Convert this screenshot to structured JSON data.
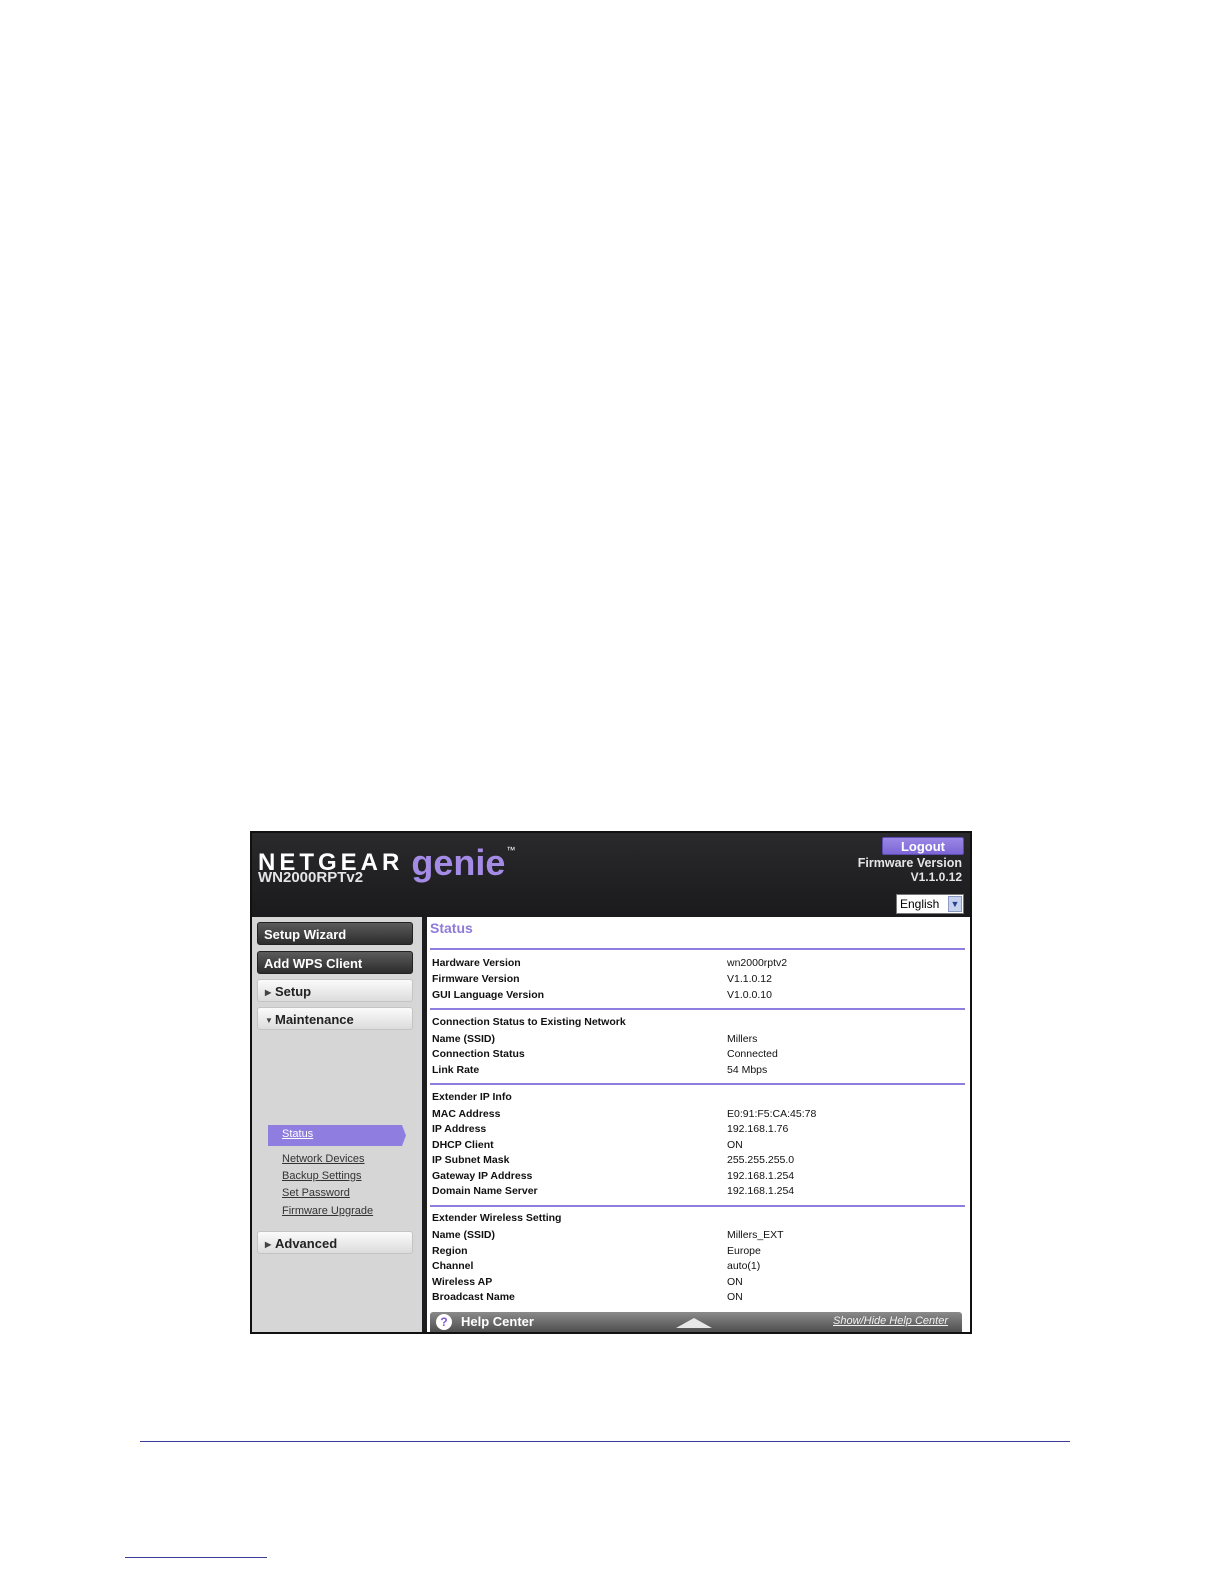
{
  "header": {
    "brand_netgear": "NETGEAR",
    "brand_genie": "genie",
    "brand_tm": "™",
    "model": "WN2000RPTv2",
    "logout_label": "Logout",
    "firmware_label": "Firmware Version",
    "firmware_value": "V1.1.0.12",
    "language_selected": "English"
  },
  "sidebar": {
    "setup_wizard": "Setup Wizard",
    "add_wps_client": "Add WPS Client",
    "setup": "Setup",
    "maintenance": "Maintenance",
    "maintenance_items": [
      "Status",
      "Network Devices",
      "Backup Settings",
      "Set Password",
      "Firmware Upgrade"
    ],
    "advanced": "Advanced"
  },
  "status": {
    "title": "Status",
    "hardware_version_label": "Hardware Version",
    "hardware_version_value": "wn2000rptv2",
    "firmware_version_label": "Firmware Version",
    "firmware_version_value": "V1.1.0.12",
    "gui_language_label": "GUI Language Version",
    "gui_language_value": "V1.0.0.10",
    "connection_section": "Connection Status to Existing Network",
    "conn_name_label": "Name (SSID)",
    "conn_name_value": "Millers",
    "conn_status_label": "Connection Status",
    "conn_status_value": "Connected",
    "link_rate_label": "Link Rate",
    "link_rate_value": "54 Mbps",
    "ip_section": "Extender IP Info",
    "mac_label": "MAC Address",
    "mac_value": "E0:91:F5:CA:45:78",
    "ip_label": "IP Address",
    "ip_value": "192.168.1.76",
    "dhcp_label": "DHCP Client",
    "dhcp_value": "ON",
    "subnet_label": "IP Subnet Mask",
    "subnet_value": "255.255.255.0",
    "gateway_label": "Gateway IP Address",
    "gateway_value": "192.168.1.254",
    "dns_label": "Domain Name Server",
    "dns_value": "192.168.1.254",
    "wireless_section": "Extender Wireless Setting",
    "w_name_label": "Name (SSID)",
    "w_name_value": "Millers_EXT",
    "region_label": "Region",
    "region_value": "Europe",
    "channel_label": "Channel",
    "channel_value": "auto(1)",
    "wireless_ap_label": "Wireless AP",
    "wireless_ap_value": "ON",
    "broadcast_label": "Broadcast Name",
    "broadcast_value": "ON"
  },
  "help": {
    "icon": "?",
    "label": "Help Center",
    "toggle": "Show/Hide Help Center"
  }
}
